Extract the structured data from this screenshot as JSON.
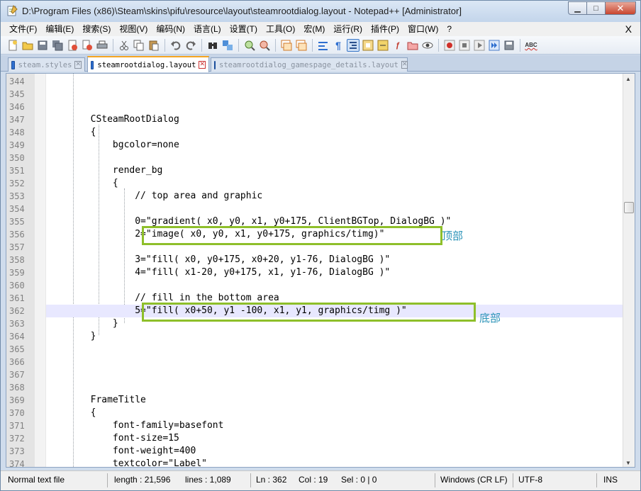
{
  "window": {
    "title": "D:\\Program Files (x86)\\Steam\\skins\\pifu\\resource\\layout\\steamrootdialog.layout - Notepad++ [Administrator]",
    "controls": {
      "minimize": "▁",
      "maximize": "□",
      "close": "✕"
    }
  },
  "menu": {
    "items": [
      "文件(F)",
      "编辑(E)",
      "搜索(S)",
      "视图(V)",
      "编码(N)",
      "语言(L)",
      "设置(T)",
      "工具(O)",
      "宏(M)",
      "运行(R)",
      "插件(P)",
      "窗口(W)",
      "?"
    ],
    "close": "X"
  },
  "toolbar": {
    "icons": [
      "new-file-icon",
      "open-file-icon",
      "save-icon",
      "save-all-icon",
      "close-icon",
      "close-all-icon",
      "print-icon",
      "cut-icon",
      "copy-icon",
      "paste-icon",
      "undo-icon",
      "redo-icon",
      "find-icon",
      "replace-icon",
      "zoom-in-icon",
      "zoom-out-icon",
      "sync-vertical-icon",
      "sync-horizontal-icon",
      "word-wrap-icon",
      "show-all-chars-icon",
      "indent-guide-icon",
      "doc-map-icon",
      "function-list-icon",
      "folder-workspace-icon",
      "doc-switcher-icon",
      "monitor-icon",
      "record-macro-icon",
      "stop-macro-icon",
      "play-macro-icon",
      "run-macro-multiple-icon",
      "save-macro-icon",
      "spell-check-icon"
    ]
  },
  "tabs": [
    {
      "label": "steam.styles",
      "active": false
    },
    {
      "label": "steamrootdialog.layout",
      "active": true
    },
    {
      "label": "steamrootdialog_gamespage_details.layout",
      "active": false
    }
  ],
  "editor": {
    "lines": [
      {
        "num": "344",
        "text": ""
      },
      {
        "num": "345",
        "text": ""
      },
      {
        "num": "346",
        "text": ""
      },
      {
        "num": "347",
        "text": "        CSteamRootDialog"
      },
      {
        "num": "348",
        "text": "        {"
      },
      {
        "num": "349",
        "text": "            bgcolor=none"
      },
      {
        "num": "350",
        "text": ""
      },
      {
        "num": "351",
        "text": "            render_bg"
      },
      {
        "num": "352",
        "text": "            {"
      },
      {
        "num": "353",
        "text": "                // top area and graphic"
      },
      {
        "num": "354",
        "text": ""
      },
      {
        "num": "355",
        "text": "                0=\"gradient( x0, y0, x1, y0+175, ClientBGTop, DialogBG )\""
      },
      {
        "num": "356",
        "text": "                2=\"image( x0, y0, x1, y0+175, graphics/timg)\""
      },
      {
        "num": "357",
        "text": ""
      },
      {
        "num": "358",
        "text": "                3=\"fill( x0, y0+175, x0+20, y1-76, DialogBG )\""
      },
      {
        "num": "359",
        "text": "                4=\"fill( x1-20, y0+175, x1, y1-76, DialogBG )\""
      },
      {
        "num": "360",
        "text": ""
      },
      {
        "num": "361",
        "text": "                // fill in the bottom area"
      },
      {
        "num": "362",
        "text": "                5=\"fill( x0+50, y1 -100, x1, y1, graphics/timg )\""
      },
      {
        "num": "363",
        "text": "            }"
      },
      {
        "num": "364",
        "text": "        }"
      },
      {
        "num": "365",
        "text": ""
      },
      {
        "num": "366",
        "text": ""
      },
      {
        "num": "367",
        "text": ""
      },
      {
        "num": "368",
        "text": ""
      },
      {
        "num": "369",
        "text": "        FrameTitle"
      },
      {
        "num": "370",
        "text": "        {"
      },
      {
        "num": "371",
        "text": "            font-family=basefont"
      },
      {
        "num": "372",
        "text": "            font-size=15"
      },
      {
        "num": "373",
        "text": "            font-weight=400"
      },
      {
        "num": "374",
        "text": "            textcolor=\"Label\""
      }
    ],
    "current_line": "362",
    "annotations": {
      "top": "顶部",
      "bottom": "底部"
    }
  },
  "status": {
    "file_type": "Normal text file",
    "length": "length : 21,596",
    "lines": "lines : 1,089",
    "ln": "Ln : 362",
    "col": "Col : 19",
    "sel": "Sel : 0 | 0",
    "eol": "Windows (CR LF)",
    "encoding": "UTF-8",
    "mode": "INS"
  },
  "colors": {
    "highlight_box": "#8ebf2a",
    "annotation_text": "#2b93b8",
    "current_line_bg": "#e8e8ff"
  }
}
